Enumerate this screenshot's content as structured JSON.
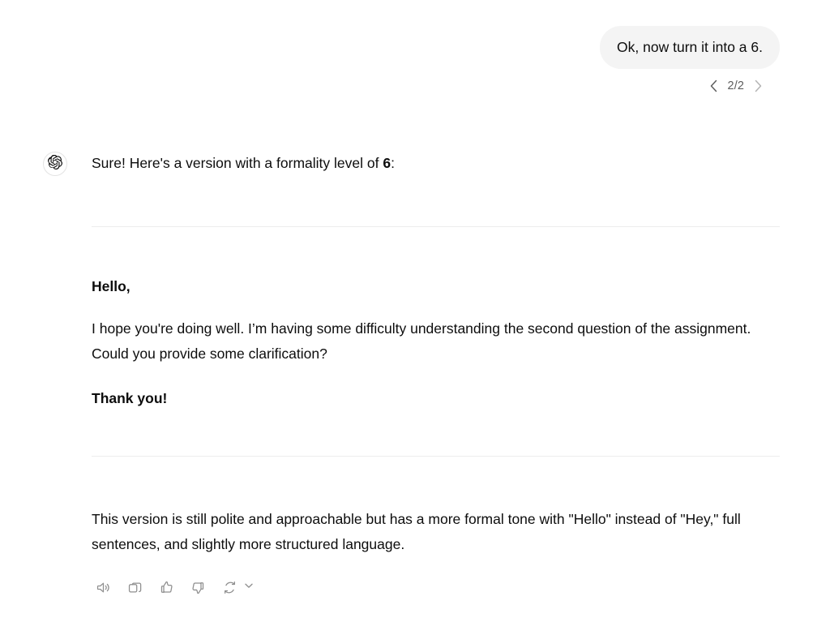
{
  "user_turn": {
    "message": "Ok, now turn it into a 6.",
    "pagination": {
      "prev_icon": "chevron-left-icon",
      "counter": "2/2",
      "next_icon": "chevron-right-icon"
    },
    "bubble_color": "#f4f4f4"
  },
  "assistant_turn": {
    "avatar_icon": "openai-logo-icon",
    "intro": {
      "before": "Sure! Here's a version with a formality level of ",
      "bold": "6",
      "after": ":"
    },
    "draft": {
      "greeting": "Hello,",
      "body": "I hope you're doing well. I’m having some difficulty understanding the second question of the assignment. Could you provide some clarification?",
      "signoff": "Thank you!"
    },
    "explanation": "This version is still polite and approachable but has a more formal tone with \"Hello\" instead of \"Hey,\" full sentences, and slightly more structured language.",
    "actions": [
      {
        "name": "read-aloud-button",
        "icon": "speaker-icon"
      },
      {
        "name": "copy-button",
        "icon": "copy-icon"
      },
      {
        "name": "thumbs-up-button",
        "icon": "thumbs-up-icon"
      },
      {
        "name": "thumbs-down-button",
        "icon": "thumbs-down-icon"
      },
      {
        "name": "regenerate-button",
        "icon": "refresh-icon"
      },
      {
        "name": "model-switch-button",
        "icon": "chevron-down-icon"
      }
    ],
    "colors": {
      "text": "#0d0d0d",
      "muted": "#8f8f8f",
      "rule": "#ececec"
    }
  }
}
